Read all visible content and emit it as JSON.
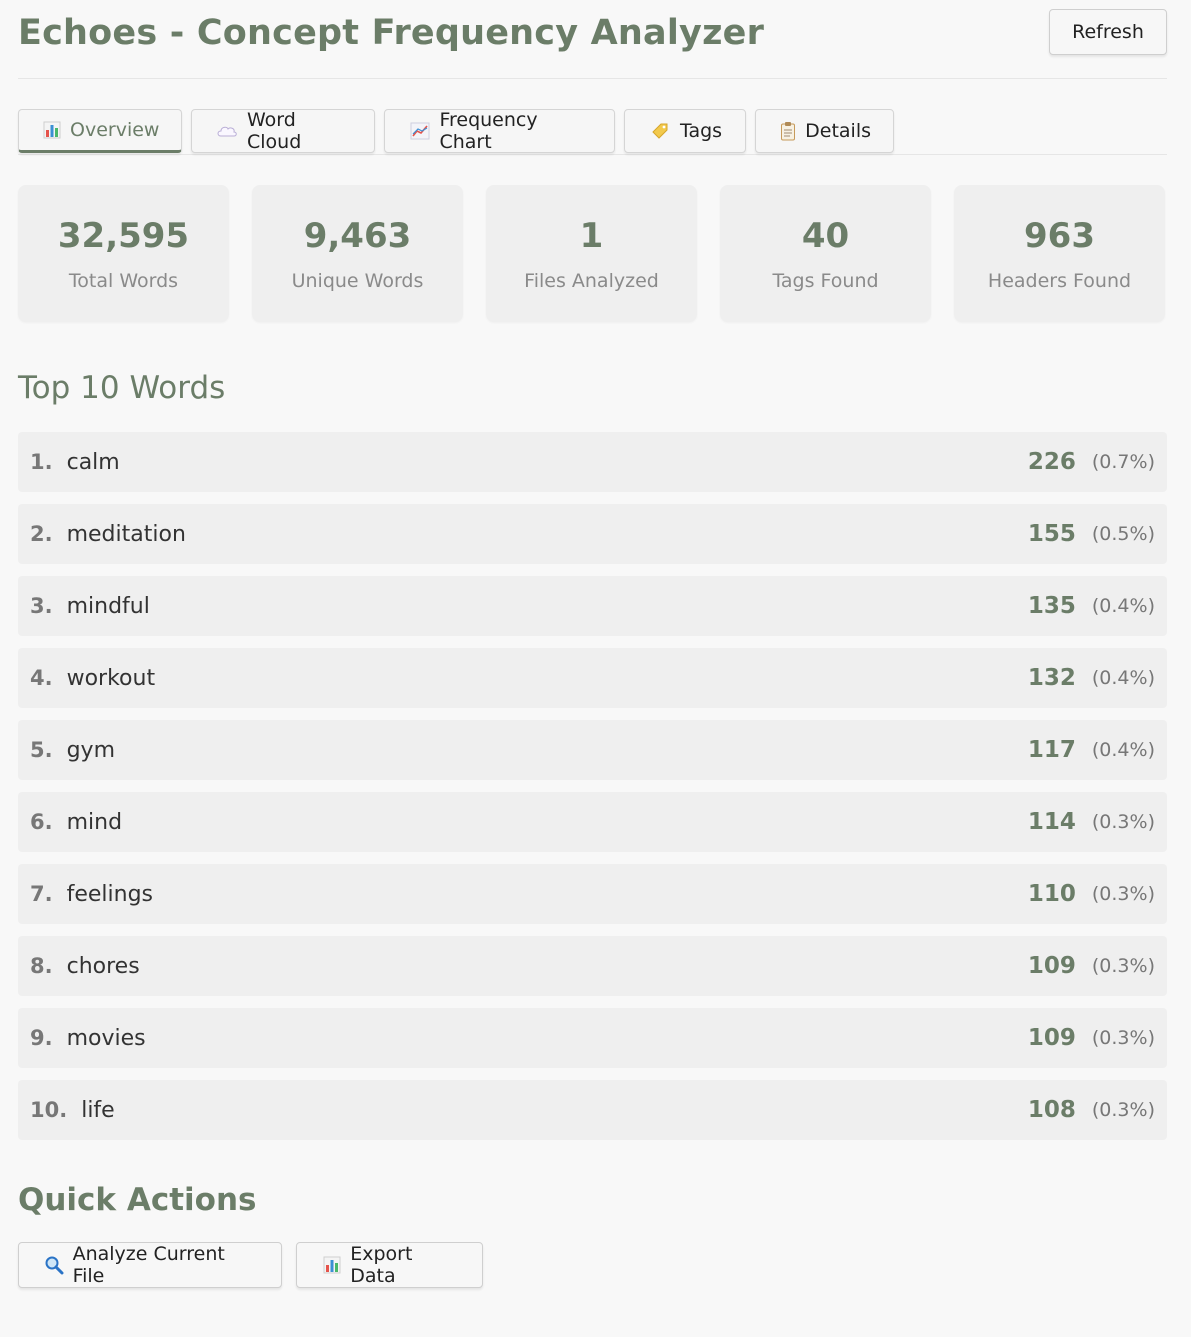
{
  "header": {
    "title": "Echoes - Concept Frequency Analyzer",
    "refresh_label": "Refresh"
  },
  "tabs": [
    {
      "label": "Overview",
      "icon": "bar-chart-icon",
      "active": true
    },
    {
      "label": "Word Cloud",
      "icon": "cloud-icon",
      "active": false
    },
    {
      "label": "Frequency Chart",
      "icon": "line-chart-icon",
      "active": false
    },
    {
      "label": "Tags",
      "icon": "tag-icon",
      "active": false
    },
    {
      "label": "Details",
      "icon": "clipboard-icon",
      "active": false
    }
  ],
  "stats": [
    {
      "value": "32,595",
      "label": "Total Words"
    },
    {
      "value": "9,463",
      "label": "Unique Words"
    },
    {
      "value": "1",
      "label": "Files Analyzed"
    },
    {
      "value": "40",
      "label": "Tags Found"
    },
    {
      "value": "963",
      "label": "Headers Found"
    }
  ],
  "top_words": {
    "title": "Top 10 Words",
    "items": [
      {
        "rank": "1.",
        "word": "calm",
        "count": "226",
        "pct": "(0.7%)"
      },
      {
        "rank": "2.",
        "word": "meditation",
        "count": "155",
        "pct": "(0.5%)"
      },
      {
        "rank": "3.",
        "word": "mindful",
        "count": "135",
        "pct": "(0.4%)"
      },
      {
        "rank": "4.",
        "word": "workout",
        "count": "132",
        "pct": "(0.4%)"
      },
      {
        "rank": "5.",
        "word": "gym",
        "count": "117",
        "pct": "(0.4%)"
      },
      {
        "rank": "6.",
        "word": "mind",
        "count": "114",
        "pct": "(0.3%)"
      },
      {
        "rank": "7.",
        "word": "feelings",
        "count": "110",
        "pct": "(0.3%)"
      },
      {
        "rank": "8.",
        "word": "chores",
        "count": "109",
        "pct": "(0.3%)"
      },
      {
        "rank": "9.",
        "word": "movies",
        "count": "109",
        "pct": "(0.3%)"
      },
      {
        "rank": "10.",
        "word": "life",
        "count": "108",
        "pct": "(0.3%)"
      }
    ]
  },
  "quick_actions": {
    "title": "Quick Actions",
    "analyze_label": "Analyze Current File",
    "analyze_icon": "magnifier-icon",
    "export_label": "Export Data",
    "export_icon": "bar-chart-icon"
  },
  "colors": {
    "accent": "#6b7d68",
    "background": "#f8f8f8",
    "card": "#efefef"
  }
}
